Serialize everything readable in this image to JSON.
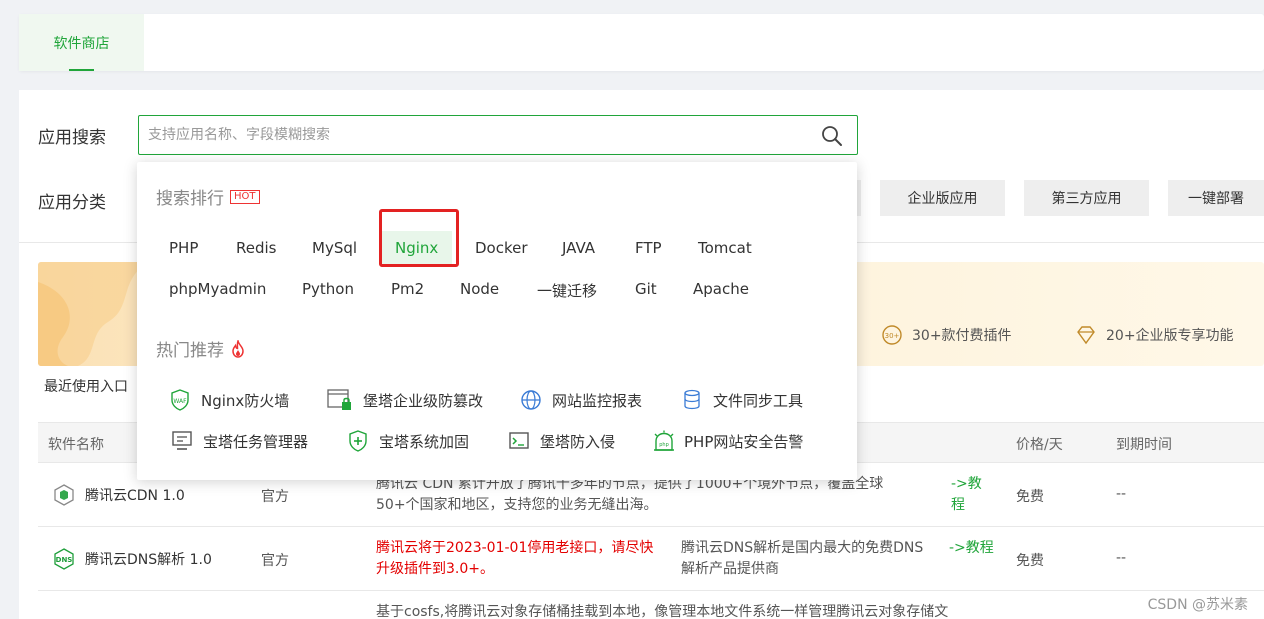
{
  "top_tab": {
    "label": "软件商店"
  },
  "search": {
    "label": "应用搜索",
    "placeholder": "支持应用名称、字段模糊搜索",
    "value": ""
  },
  "category": {
    "label": "应用分类",
    "buttons": [
      "企业版应用",
      "第三方应用",
      "一键部署"
    ]
  },
  "banner": {
    "features": [
      "30+款付费插件",
      "20+企业版专享功能"
    ]
  },
  "recent_label": "最近使用入口",
  "table": {
    "headers": {
      "name": "软件名称",
      "price": "价格/天",
      "expire": "到期时间"
    },
    "rows": [
      {
        "name": "腾讯云CDN 1.0",
        "developer": "官方",
        "desc_line1": "腾讯云 CDN 累计开放了腾讯十多年的节点，提供了1000+个境外节点，覆盖全球",
        "desc_line2": "50+个国家和地区，支持您的业务无缝出海。",
        "tutorial_line1": "->教",
        "tutorial_line2": "程",
        "price": "免费",
        "expire": "--"
      },
      {
        "name": "腾讯云DNS解析 1.0",
        "developer": "官方",
        "warn_line1": "腾讯云将于2023-01-01停用老接口，请尽快",
        "warn_line2": "升级插件到3.0+。",
        "desc_line1": "腾讯云DNS解析是国内最大的免费DNS",
        "desc_line2": "解析产品提供商",
        "tutorial_line1": "->教程",
        "price": "免费",
        "expire": "--"
      },
      {
        "desc_line1": "基于cosfs,将腾讯云对象存储桶挂载到本地，像管理本地文件系统一样管理腾讯云对象存储文"
      }
    ]
  },
  "watermark": "CSDN @苏米素",
  "dropdown": {
    "ranking_title": "搜索排行",
    "hot_badge": "HOT",
    "ranking_row1": [
      "PHP",
      "Redis",
      "MySql",
      "Nginx",
      "Docker",
      "JAVA",
      "FTP",
      "Tomcat"
    ],
    "ranking_row2": [
      "phpMyadmin",
      "Python",
      "Pm2",
      "Node",
      "一键迁移",
      "Git",
      "Apache"
    ],
    "recommend_title": "热门推荐",
    "recommend_row1": [
      "Nginx防火墙",
      "堡塔企业级防篡改",
      "网站监控报表",
      "文件同步工具"
    ],
    "recommend_row2": [
      "宝塔任务管理器",
      "宝塔系统加固",
      "堡塔防入侵",
      "PHP网站安全告警"
    ]
  },
  "colors": {
    "accent": "#20a53a",
    "warning": "#e30000",
    "highlight_box": "#e32222"
  }
}
